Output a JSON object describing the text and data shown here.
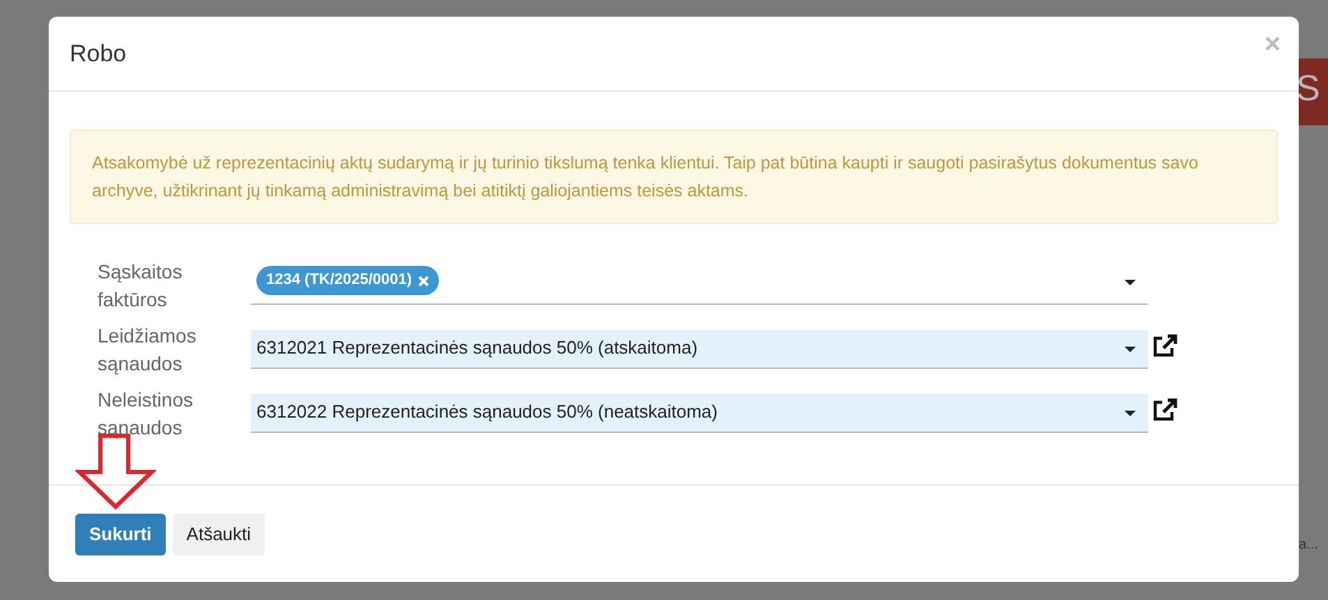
{
  "background": {
    "button_fragment": "S",
    "text_fragment": "a..."
  },
  "dialog": {
    "title": "Robo",
    "close": "×",
    "alert": "Atsakomybė už reprezentacinių aktų sudarymą ir jų turinio tikslumą tenka klientui. Taip pat būtina kaupti ir saugoti pasirašytus dokumentus savo archyve, užtikrinant jų tinkamą administravimą bei atitiktį galiojantiems teisės aktams.",
    "fields": [
      {
        "kind": "tags",
        "label": "Sąskaitos faktūros",
        "tags": [
          "1234 (TK/2025/0001)"
        ],
        "link": false
      },
      {
        "kind": "select",
        "label": "Leidžiamos sąnaudos",
        "value": "6312021 Reprezentacinės sąnaudos 50% (atskaitoma)",
        "link": true
      },
      {
        "kind": "select",
        "label": "Neleistinos sąnaudos",
        "value": "6312022 Reprezentacinės sąnaudos 50% (neatskaitoma)",
        "link": true
      }
    ],
    "buttons": [
      {
        "label": "Sukurti",
        "primary": true
      },
      {
        "label": "Atšaukti",
        "primary": false
      }
    ]
  }
}
